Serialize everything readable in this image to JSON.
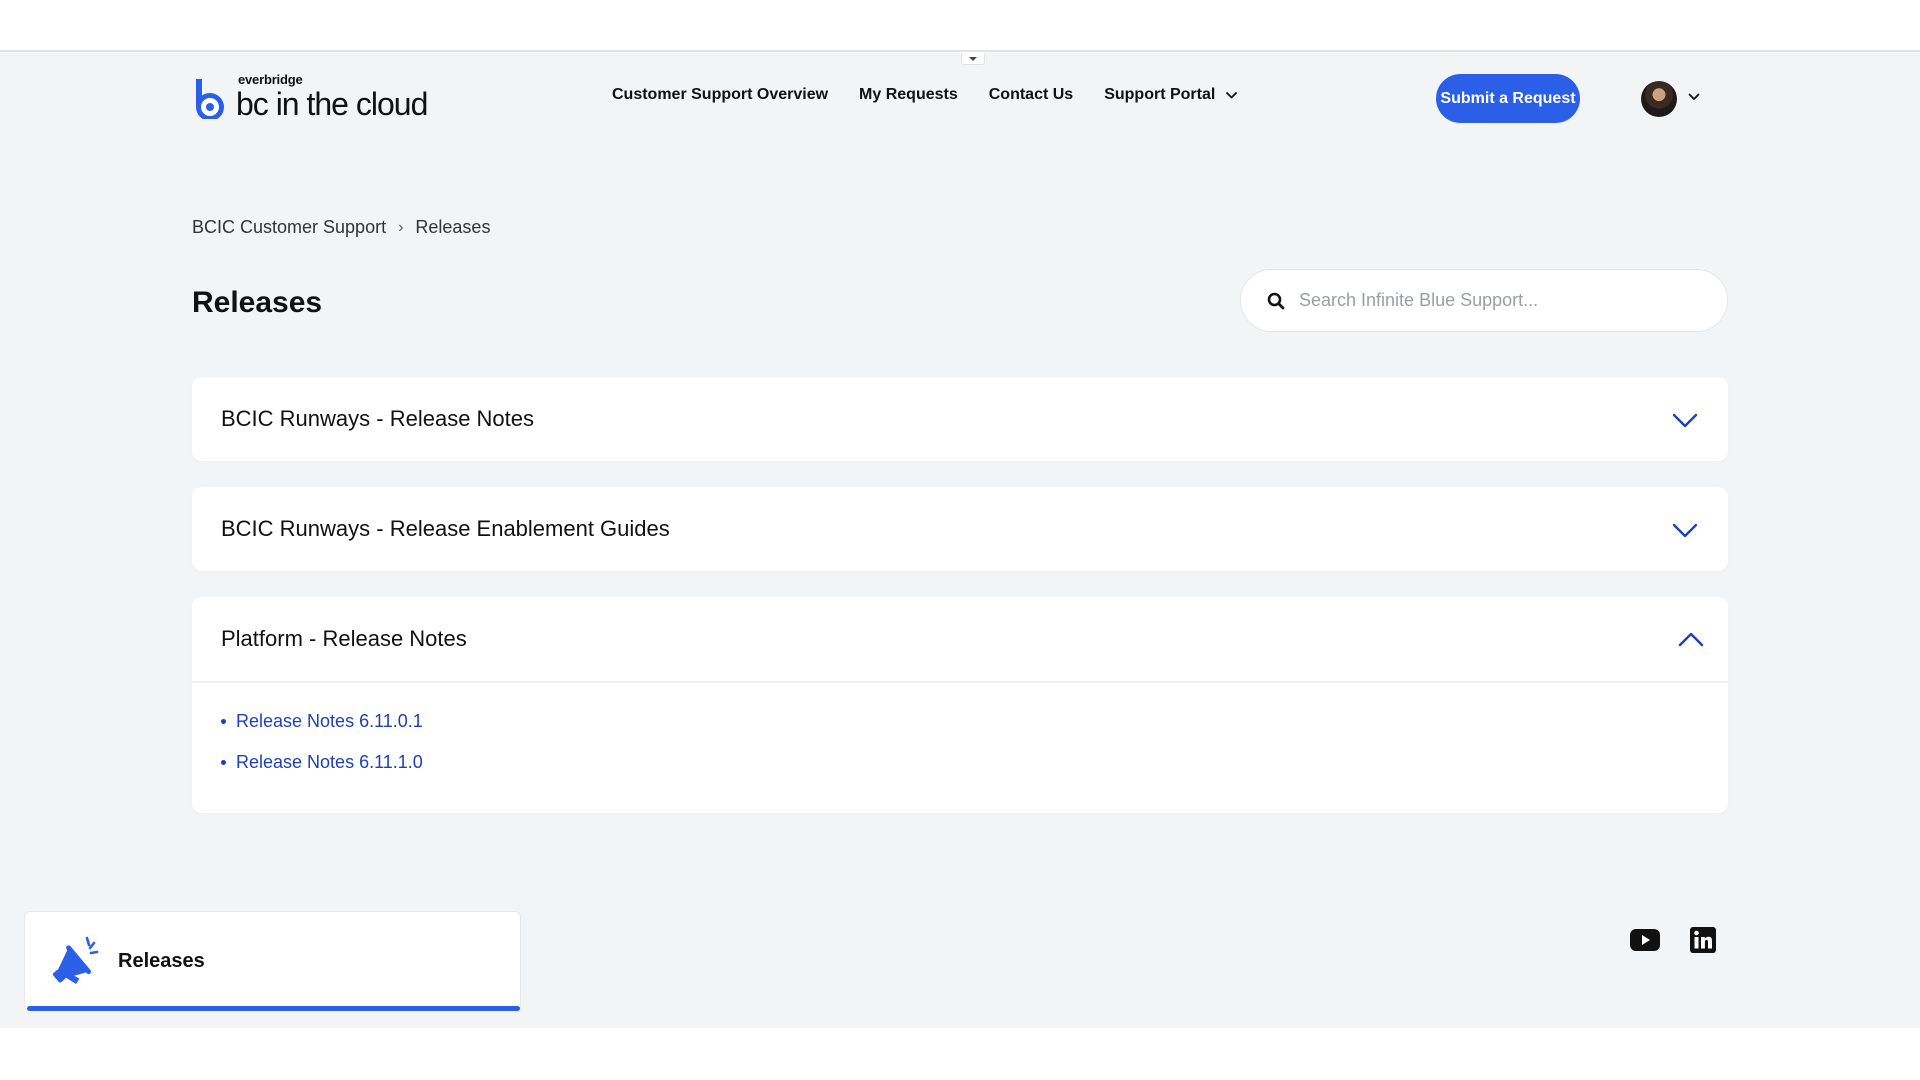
{
  "header": {
    "logo_small": "everbridge",
    "logo_big": "bc in the cloud",
    "nav": [
      {
        "label": "Customer Support Overview"
      },
      {
        "label": "My Requests"
      },
      {
        "label": "Contact Us"
      },
      {
        "label": "Support Portal"
      }
    ],
    "submit_label": "Submit a Request"
  },
  "breadcrumb": {
    "items": [
      "BCIC Customer Support",
      "Releases"
    ],
    "separator": "›"
  },
  "page_title": "Releases",
  "search": {
    "placeholder": "Search Infinite Blue Support..."
  },
  "accordions": [
    {
      "title": "BCIC Runways - Release Notes",
      "expanded": false
    },
    {
      "title": "BCIC Runways - Release Enablement Guides",
      "expanded": false
    },
    {
      "title": "Platform - Release Notes",
      "expanded": true,
      "links": [
        "Release Notes 6.11.0.1",
        "Release Notes 6.11.1.0"
      ]
    }
  ],
  "releases_card": {
    "label": "Releases",
    "icon": "megaphone-icon"
  },
  "social": [
    "youtube-icon",
    "linkedin-icon"
  ],
  "colors": {
    "accent": "#2c5fe8",
    "link": "#1d3fb8",
    "page_bg": "#f3f4f6"
  }
}
